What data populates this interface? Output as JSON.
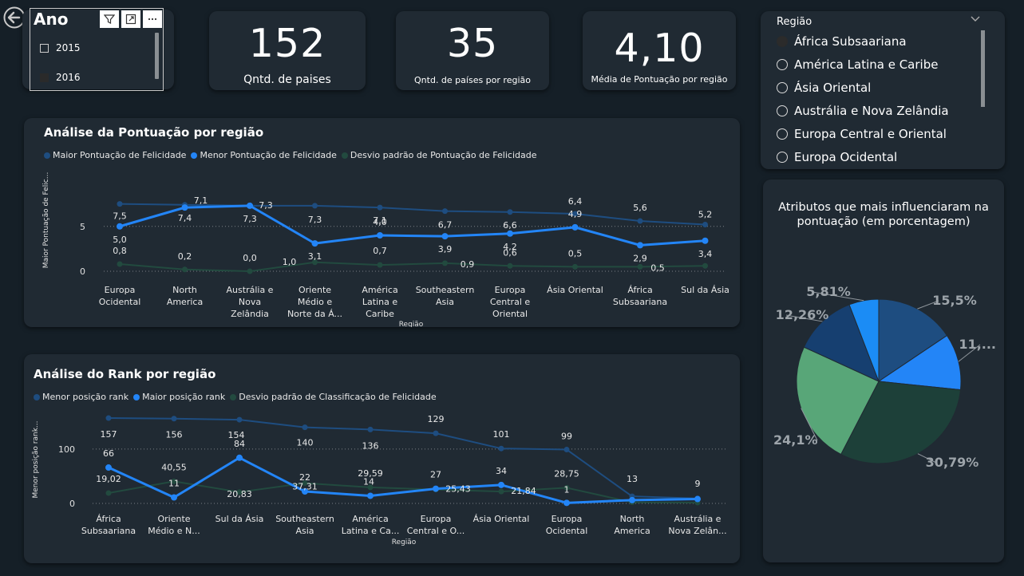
{
  "ano_slicer": {
    "title": "Ano",
    "items": [
      {
        "label": "2015",
        "selected": false
      },
      {
        "label": "2016",
        "selected": true
      }
    ]
  },
  "kpis": [
    {
      "value": "152",
      "label": "Qntd. de paises"
    },
    {
      "value": "35",
      "label": "Qntd. de países por região"
    },
    {
      "value": "4,10",
      "label": "Média de Pontuação por região"
    }
  ],
  "region_slicer": {
    "title": "Região",
    "items": [
      {
        "label": "África Subsaariana",
        "selected": true
      },
      {
        "label": "América Latina e Caribe",
        "selected": false
      },
      {
        "label": "Ásia Oriental",
        "selected": false
      },
      {
        "label": "Austrália e Nova Zelândia",
        "selected": false
      },
      {
        "label": "Europa Central e Oriental",
        "selected": false
      },
      {
        "label": "Europa Ocidental",
        "selected": false
      }
    ]
  },
  "colors": {
    "dark_blue": "#1e4d80",
    "bright_blue": "#2385f7",
    "dark_green": "#224a3f",
    "pie_green": "#58a678",
    "pie_teal": "#1d4039"
  },
  "chart_data": [
    {
      "type": "line",
      "title": "Análise da Pontuação por região",
      "xlabel": "Região",
      "ylabel": "Maior Pontuação de Felic...",
      "categories": [
        [
          "Europa",
          "Ocidental"
        ],
        [
          "North",
          "America"
        ],
        [
          "Austrália e",
          "Nova",
          "Zelândia"
        ],
        [
          "Oriente",
          "Médio e",
          "Norte da Á..."
        ],
        [
          "América",
          "Latina e",
          "Caribe"
        ],
        [
          "Southeastern",
          "Asia"
        ],
        [
          "Europa",
          "Central e",
          "Oriental"
        ],
        [
          "Ásia Oriental"
        ],
        [
          "África",
          "Subsaariana"
        ],
        [
          "Sul da Ásia"
        ]
      ],
      "yticks": [
        "0",
        "5"
      ],
      "ylim": [
        0,
        8
      ],
      "series": [
        {
          "name": "Maior Pontuação de Felicidade",
          "values": [
            7.5,
            7.4,
            7.3,
            7.3,
            7.1,
            6.7,
            6.6,
            6.4,
            5.6,
            5.2
          ],
          "labels": [
            "7,5",
            "7,4",
            "7,3",
            "7,3",
            "7,1",
            "6,7",
            "6,6",
            "6,4",
            "5,6",
            "5,2"
          ]
        },
        {
          "name": "Menor Pontuação de Felicidade",
          "values": [
            5.0,
            7.1,
            7.3,
            3.1,
            4.0,
            3.9,
            4.2,
            4.9,
            2.9,
            3.4
          ],
          "labels": [
            "5,0",
            "7,1",
            "7,3",
            "3,1",
            "4,0",
            "3,9",
            "4,2",
            "4,9",
            "2,9",
            "3,4"
          ]
        },
        {
          "name": "Desvio padrão de Pontuação de Felicidade",
          "values": [
            0.8,
            0.2,
            0.0,
            1.0,
            0.7,
            0.9,
            0.6,
            0.5,
            0.5,
            0.6
          ],
          "labels": [
            "0,8",
            "0,2",
            "0,0",
            "1,0",
            "0,7",
            "0,9",
            "0,6",
            "0,5",
            "0,5",
            ""
          ]
        }
      ]
    },
    {
      "type": "line",
      "title": "Análise do Rank por região",
      "xlabel": "Região",
      "ylabel": "Menor posição rank...",
      "categories": [
        [
          "África",
          "Subsaariana"
        ],
        [
          "Oriente",
          "Médio e N..."
        ],
        [
          "Sul da Ásia"
        ],
        [
          "Southeastern",
          "Asia"
        ],
        [
          "América",
          "Latina e Ca..."
        ],
        [
          "Europa",
          "Central e O..."
        ],
        [
          "Ásia Oriental"
        ],
        [
          "Europa",
          "Ocidental"
        ],
        [
          "North",
          "America"
        ],
        [
          "Austrália e",
          "Nova Zelân..."
        ]
      ],
      "yticks": [
        "0",
        "100"
      ],
      "ylim": [
        0,
        160
      ],
      "series": [
        {
          "name": "Menor posição rank",
          "values": [
            157,
            156,
            154,
            140,
            136,
            129,
            101,
            99,
            13,
            9
          ],
          "labels": [
            "157",
            "156",
            "154",
            "140",
            "136",
            "129",
            "101",
            "99",
            "13",
            "9"
          ]
        },
        {
          "name": "Maior posição rank",
          "values": [
            66,
            11,
            84,
            22,
            14,
            27,
            34,
            1,
            6,
            8
          ],
          "labels": [
            "66",
            "11",
            "84",
            "22",
            "14",
            "27",
            "34",
            "1",
            "",
            ""
          ]
        },
        {
          "name": "Desvio padrão de Classificação de Felicidade",
          "values": [
            19.02,
            40.55,
            20.83,
            37.31,
            29.59,
            25.43,
            21.84,
            28.75,
            2.0,
            1.5
          ],
          "labels": [
            "19,02",
            "40,55",
            "20,83",
            "37,31",
            "29,59",
            "25,43",
            "21,84",
            "28,75",
            "",
            ""
          ]
        }
      ]
    },
    {
      "type": "pie",
      "title": "Atributos que mais influenciaram na pontuação (em porcentagem)",
      "slices": [
        {
          "label": "15,5%",
          "value": 15.5,
          "color": "#1e4d80"
        },
        {
          "label": "11,...",
          "value": 11.0,
          "color": "#2385f7"
        },
        {
          "label": "30,79%",
          "value": 30.79,
          "color": "#1d4039"
        },
        {
          "label": "24,1%",
          "value": 24.1,
          "color": "#58a678"
        },
        {
          "label": "12,26%",
          "value": 12.26,
          "color": "#163f70"
        },
        {
          "label": "5,81%",
          "value": 5.81,
          "color": "#1b8cf5"
        }
      ]
    }
  ]
}
